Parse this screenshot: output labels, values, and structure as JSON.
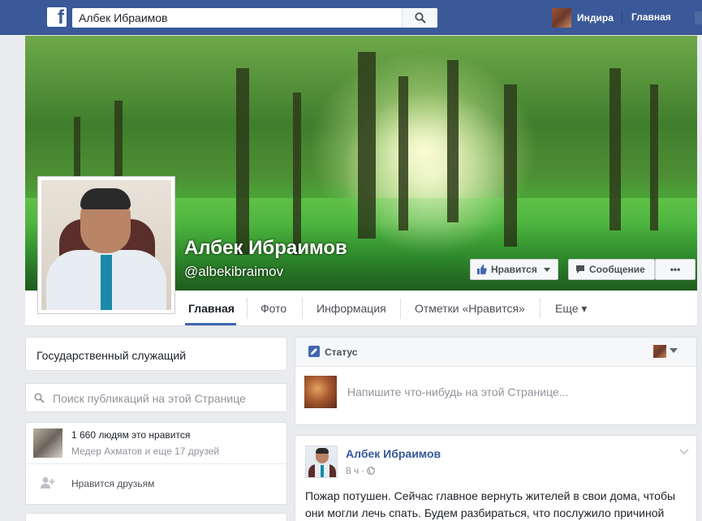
{
  "topbar": {
    "search_value": "Албек Ибраимов",
    "user_name": "Индира",
    "home_label": "Главная"
  },
  "icons": {
    "logo": "facebook-logo",
    "search": "search-icon",
    "like": "thumbs-up-icon",
    "message": "message-icon",
    "more": "more-dots-icon",
    "status": "pencil-icon",
    "friends": "add-friend-icon",
    "privacy": "globe-icon"
  },
  "colors": {
    "brand": "#3b5998",
    "link": "#365899",
    "accent": "#4267b2"
  },
  "page": {
    "name": "Албек Ибраимов",
    "handle": "@albekibraimov",
    "like_button": "Нравится",
    "message_button": "Сообщение",
    "more_button": "•••"
  },
  "nav": {
    "tabs": [
      {
        "label": "Главная"
      },
      {
        "label": "Фото"
      },
      {
        "label": "Информация"
      },
      {
        "label": "Отметки «Нравится»"
      },
      {
        "label": "Еще ▾"
      }
    ]
  },
  "left": {
    "category": "Государственный служащий",
    "search_placeholder": "Поиск публикаций на этой Странице",
    "likes_count": "1 660 людям это нравится",
    "likes_friends": "Медер Ахматов и еще 17 друзей",
    "friends_label": "Нравится друзьям"
  },
  "composer": {
    "status_label": "Статус",
    "placeholder": "Напишите что-нибудь на этой Странице..."
  },
  "post": {
    "author": "Албек Ибраимов",
    "time": "8 ч",
    "text_line1": "Пожар потушен. Сейчас главное вернуть жителей в свои дома, чтобы",
    "text_line2": "они могли лечь спать. Будем разбираться, что послужило причиной"
  }
}
